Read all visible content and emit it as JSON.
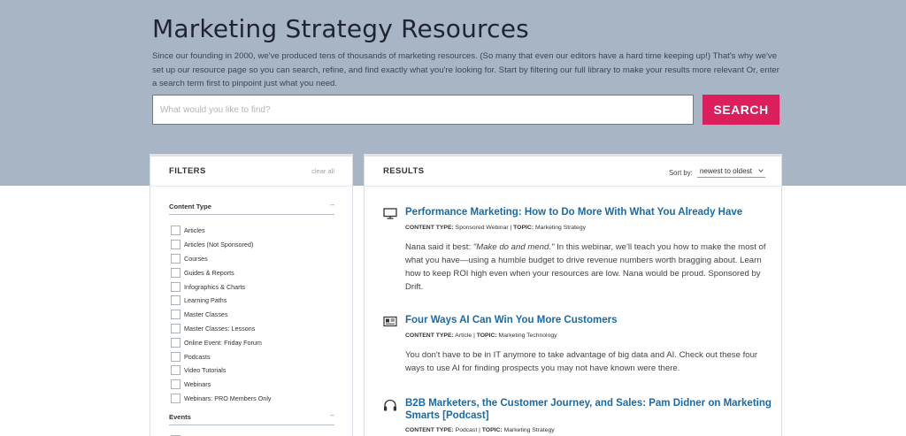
{
  "header": {
    "title": "Marketing Strategy Resources",
    "intro": "Since our founding in 2000, we've produced tens of thousands of marketing resources. (So many that even our editors have a hard time keeping up!) That's why we've set up our resource page so you can search, refine, and find exactly what you're looking for. Start by filtering our full library to make your results more relevant Or, enter a search term first to pinpoint just what you need."
  },
  "search": {
    "placeholder": "What would you like to find?",
    "value": "",
    "button_label": "SEARCH"
  },
  "filters": {
    "title": "FILTERS",
    "clear_label": "clear all",
    "sections": [
      {
        "label": "Content Type",
        "toggle": "–",
        "items": [
          "Articles",
          "Articles (Not Sponsored)",
          "Courses",
          "Guides & Reports",
          "Infographics & Charts",
          "Learning Paths",
          "Master Classes",
          "Master Classes: Lessons",
          "Online Event: Friday Forum",
          "Podcasts",
          "Video Tutorials",
          "Webinars",
          "Webinars: PRO Members Only"
        ]
      },
      {
        "label": "Events",
        "toggle": "–",
        "items": []
      }
    ]
  },
  "results": {
    "title": "RESULTS",
    "sort_label": "Sort by:",
    "sort_value": "newest to oldest",
    "items": [
      {
        "icon": "monitor-icon",
        "title": "Performance Marketing: How to Do More With What You Already Have",
        "content_type_label": "CONTENT TYPE:",
        "content_type": "Sponsored Webinar",
        "separator": "|",
        "topic_label": "TOPIC:",
        "topic": "Marketing Strategy",
        "desc_prefix": "Nana said it best: ",
        "desc_italic": "\"Make do and mend.\"",
        "desc": " In this webinar, we'll teach you how to make the most of what you have—using a humble budget to drive revenue numbers worth bragging about. Learn how to keep ROI high even when your resources are low. Nana would be proud. Sponsored by Drift."
      },
      {
        "icon": "newspaper-icon",
        "title": "Four Ways AI Can Win You More Customers",
        "content_type_label": "CONTENT TYPE:",
        "content_type": "Article",
        "separator": "|",
        "topic_label": "TOPIC:",
        "topic": "Marketing Technology",
        "desc_prefix": "",
        "desc_italic": "",
        "desc": "You don't have to be in IT anymore to take advantage of big data and AI. Check out these four ways to use AI for finding prospects you may not have known were there."
      },
      {
        "icon": "headphones-icon",
        "title": "B2B Marketers, the Customer Journey, and Sales: Pam Didner on Marketing Smarts [Podcast]",
        "content_type_label": "CONTENT TYPE:",
        "content_type": "Podcast",
        "separator": "|",
        "topic_label": "TOPIC:",
        "topic": "Marketing Strategy",
        "desc_prefix": "",
        "desc_italic": "",
        "desc": ""
      }
    ]
  },
  "colors": {
    "hero_bg": "#a8b5c4",
    "accent": "#dc1f5c",
    "link": "#1a6aa8"
  }
}
